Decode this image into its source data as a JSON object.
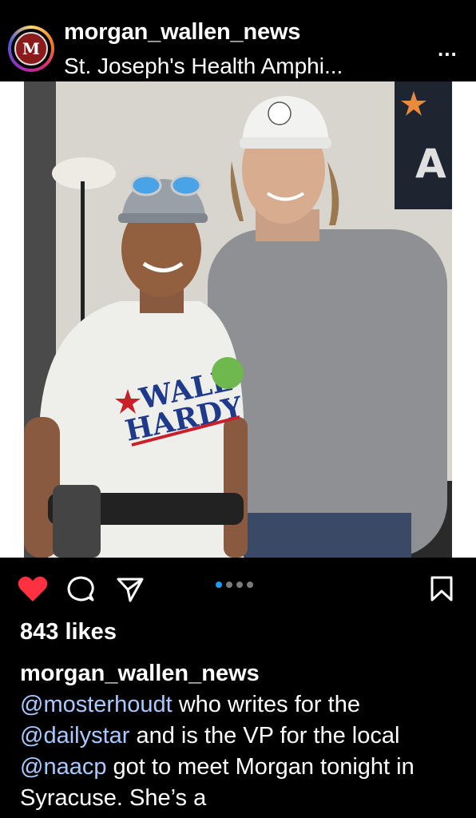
{
  "header": {
    "username": "morgan_wallen_news",
    "location": "St. Joseph's Health Amphi...",
    "more_label": "...",
    "avatar_letter": "M"
  },
  "post": {
    "photo_alt": "photo",
    "carousel": {
      "count": 4,
      "active_index": 0
    },
    "likes": "843 likes",
    "shirt_text_1": "WALL",
    "shirt_text_2": "HARDY"
  },
  "caption": {
    "user": "morgan_wallen_news",
    "mention_1": "@mosterhoudt",
    "text_1": " who writes for the ",
    "mention_2": "@dailystar",
    "text_2": " and is the VP for the local ",
    "mention_3": "@naacp",
    "text_3": " got to meet Morgan tonight in Syracuse.  She’s a"
  },
  "icons": {
    "like": "heart-icon",
    "comment": "comment-icon",
    "share": "paper-plane-icon",
    "save": "bookmark-icon"
  },
  "colors": {
    "like_red": "#ff3040",
    "carousel_active": "#1d9bf0",
    "mention": "#a9c9ff"
  }
}
